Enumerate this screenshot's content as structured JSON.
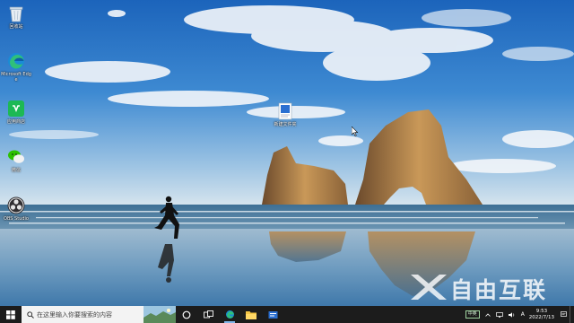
{
  "desktop": {
    "icons": [
      {
        "name": "回收站",
        "icon": "recycle-bin-icon"
      },
      {
        "name": "Microsoft Edge",
        "icon": "edge-icon"
      },
      {
        "name": "应用商店",
        "icon": "store-icon"
      },
      {
        "name": "微信",
        "icon": "wechat-icon"
      },
      {
        "name": "OBS Studio",
        "icon": "obs-icon"
      },
      {
        "name": "新建文件夹",
        "icon": "document-icon"
      }
    ]
  },
  "watermark": {
    "text": "自由互联"
  },
  "taskbar": {
    "search_placeholder": "在这里输入你要搜索的内容",
    "apps": [
      "cortana-icon",
      "task-view-icon",
      "edge-icon",
      "file-explorer-icon",
      "settings-icon"
    ],
    "tray": {
      "ime_label": "中英",
      "ime_mode": "A",
      "time": "9:53",
      "date": "2022/7/13"
    }
  },
  "colors": {
    "sky_top": "#1f6fc4",
    "sea": "#5d87a6",
    "taskbar": "#1c1c1c",
    "accent": "#7fb4e8"
  }
}
